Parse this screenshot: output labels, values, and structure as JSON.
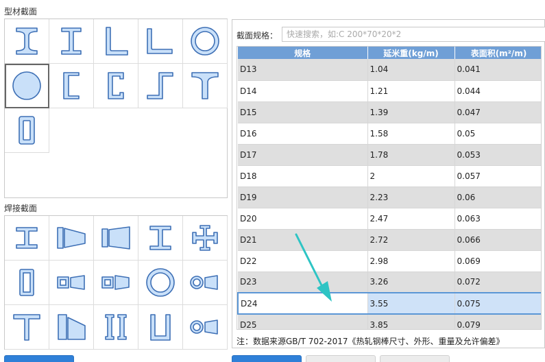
{
  "profile_section": {
    "title": "型材截面"
  },
  "weld_section": {
    "title": "焊接截面"
  },
  "profile_icons": [
    "i-beam-icon",
    "narrow-i-beam-icon",
    "angle-icon",
    "angle-lipped-icon",
    "round-tube-icon",
    "round-bar-icon",
    "channel-icon",
    "c-channel-icon",
    "z-section-icon",
    "t-section-icon",
    "rect-tube-icon"
  ],
  "weld_icons": [
    "welded-i-beam-icon",
    "tapered-i-beam-icon",
    "tapered-i-beam-2-icon",
    "welded-h-beam-icon",
    "cross-section-icon",
    "welded-box-icon",
    "box-tapered-icon",
    "box-tapered-2-icon",
    "welded-round-tube-icon",
    "tube-tapered-icon",
    "welded-t-icon",
    "tapered-t-icon",
    "double-channel-icon",
    "welded-channel-icon",
    "oval-tapered-icon"
  ],
  "search": {
    "label": "截面规格：",
    "placeholder": "快速搜索，如:C 200*70*20*2"
  },
  "table": {
    "columns": [
      "规格",
      "延米重(kg/m)",
      "表面积(m²/m)"
    ],
    "rows": [
      [
        "D13",
        "1.04",
        "0.041"
      ],
      [
        "D14",
        "1.21",
        "0.044"
      ],
      [
        "D15",
        "1.39",
        "0.047"
      ],
      [
        "D16",
        "1.58",
        "0.05"
      ],
      [
        "D17",
        "1.78",
        "0.053"
      ],
      [
        "D18",
        "2",
        "0.057"
      ],
      [
        "D19",
        "2.23",
        "0.06"
      ],
      [
        "D20",
        "2.47",
        "0.063"
      ],
      [
        "D21",
        "2.72",
        "0.066"
      ],
      [
        "D22",
        "2.98",
        "0.069"
      ],
      [
        "D23",
        "3.26",
        "0.072"
      ],
      [
        "D24",
        "3.55",
        "0.075"
      ],
      [
        "D25",
        "3.85",
        "0.079"
      ]
    ],
    "selected_index": 11
  },
  "note": "注：数据来源GB/T 702-2017《热轧钢棒尺寸、外形、重量及允许偏差》",
  "colors": {
    "accent": "#2f80d8",
    "header": "#6f9fd6",
    "selected_row": "#cfe2f8",
    "arrow": "#2ec4c4"
  }
}
